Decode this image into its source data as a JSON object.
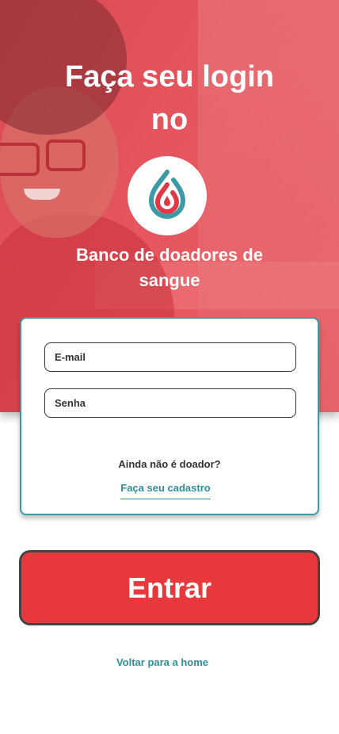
{
  "header": {
    "title": "Faça seu login no",
    "subtitle": "Banco de doadores de sangue",
    "logo_icon": "blood-drop-icon"
  },
  "form": {
    "email_placeholder": "E-mail",
    "password_placeholder": "Senha",
    "question": "Ainda não é doador?",
    "register_link": "Faça seu cadastro"
  },
  "actions": {
    "submit_label": "Entrar",
    "home_link": "Voltar para a home"
  },
  "colors": {
    "brand_red": "#e8383c",
    "accent_teal": "#3b9aa6",
    "link_teal": "#2e8f9b"
  }
}
